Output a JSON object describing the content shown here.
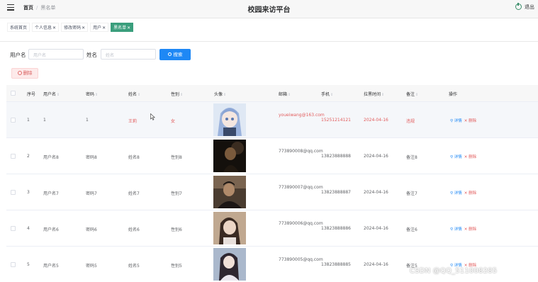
{
  "header": {
    "breadcrumb_home": "首页",
    "breadcrumb_sep": "/",
    "breadcrumb_current": "黑名单",
    "app_title": "校园来访平台",
    "logout_label": "退出",
    "menu_icon": "menu-fold-icon",
    "logout_icon": "power-icon"
  },
  "tabs": [
    {
      "label": "系统首页",
      "closable": false
    },
    {
      "label": "个人信息",
      "closable": true
    },
    {
      "label": "修改密码",
      "closable": true
    },
    {
      "label": "用户",
      "closable": true
    },
    {
      "label": "黑名单",
      "closable": true,
      "active": true
    }
  ],
  "search": {
    "username_label": "用户名",
    "username_placeholder": "用户名",
    "name_label": "姓名",
    "name_placeholder": "姓名",
    "search_button": "搜索"
  },
  "actions": {
    "delete_button": "删除"
  },
  "table": {
    "columns": [
      "序号",
      "用户名",
      "密码",
      "姓名",
      "性别",
      "头像",
      "邮箱",
      "手机",
      "拉黑时间",
      "备注",
      "操作"
    ],
    "rows": [
      {
        "index": "1",
        "username": "1",
        "password": "1",
        "name": "王莉",
        "gender": "女",
        "email": "youeiwang@163.com",
        "phone": "15251214121",
        "date": "2024-04-16",
        "note": "违规",
        "detail": "详情",
        "delete": "删除",
        "avatar_colors": [
          "#c8d8ee",
          "#8ea8d8",
          "#e8eef8"
        ]
      },
      {
        "index": "2",
        "username": "用户名8",
        "password": "密码8",
        "name": "姓名8",
        "gender": "性别8",
        "email": "773890008@qq.com",
        "phone": "13823888888",
        "date": "2024-04-16",
        "note": "备注8",
        "detail": "详情",
        "delete": "删除",
        "avatar_colors": [
          "#1a1410",
          "#6a4a30",
          "#2a2018"
        ]
      },
      {
        "index": "3",
        "username": "用户名7",
        "password": "密码7",
        "name": "姓名7",
        "gender": "性别7",
        "email": "773890007@qq.com",
        "phone": "13823888887",
        "date": "2024-04-16",
        "note": "备注7",
        "detail": "详情",
        "delete": "删除",
        "avatar_colors": [
          "#5a4a3c",
          "#2a2220",
          "#9a8068"
        ]
      },
      {
        "index": "4",
        "username": "用户名6",
        "password": "密码6",
        "name": "姓名6",
        "gender": "性别6",
        "email": "773890006@qq.com",
        "phone": "13823888886",
        "date": "2024-04-16",
        "note": "备注6",
        "detail": "详情",
        "delete": "删除",
        "avatar_colors": [
          "#b89a80",
          "#3a2a22",
          "#d8c0a8"
        ]
      },
      {
        "index": "5",
        "username": "用户名5",
        "password": "密码5",
        "name": "姓名5",
        "gender": "性别5",
        "email": "773890005@qq.com",
        "phone": "13823888885",
        "date": "2024-04-16",
        "note": "备注5",
        "detail": "详情",
        "delete": "删除",
        "avatar_colors": [
          "#8aa0c0",
          "#e8e4e8",
          "#3a3040"
        ]
      }
    ]
  },
  "watermark": "CSDN @QQ_511008285",
  "colors": {
    "accent": "#3a9e7c",
    "primary": "#1e88f5",
    "danger": "#e25c5c"
  }
}
